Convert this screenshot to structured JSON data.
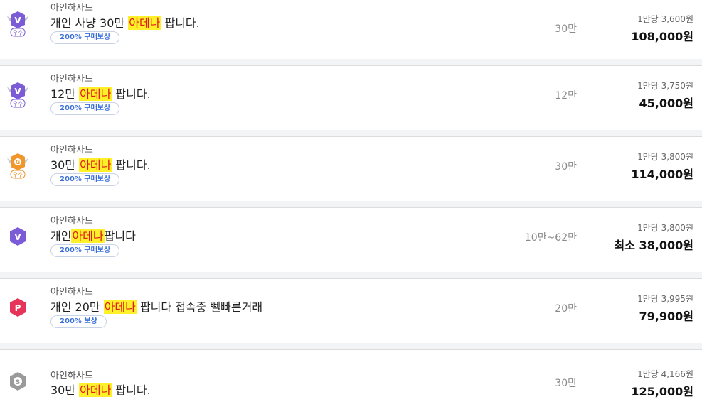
{
  "listings": [
    {
      "server": "아인하사드",
      "title_before": "개인 사냥 30만 ",
      "highlight": "아데나",
      "title_after": " 팝니다.",
      "tag": "200% 구매보상",
      "quantity": "30만",
      "unit_price": "1만당 3,600원",
      "total": "108,000원",
      "badge": {
        "icon": "v-grade-winged-icon",
        "letter": "V",
        "grade": "우수",
        "color": "#7b5bd6"
      }
    },
    {
      "server": "아인하사드",
      "title_before": "12만 ",
      "highlight": "아데나",
      "title_after": " 팝니다.",
      "tag": "200% 구매보상",
      "quantity": "12만",
      "unit_price": "1만당 3,750원",
      "total": "45,000원",
      "badge": {
        "icon": "v-grade-winged-icon",
        "letter": "V",
        "grade": "우수",
        "color": "#7b5bd6"
      }
    },
    {
      "server": "아인하사드",
      "title_before": "30만 ",
      "highlight": "아데나",
      "title_after": " 팝니다.",
      "tag": "200% 구매보상",
      "quantity": "30만",
      "unit_price": "1만당 3,800원",
      "total": "114,000원",
      "badge": {
        "icon": "g-grade-winged-icon",
        "letter": "G",
        "grade": "우수",
        "color": "#f0962a"
      }
    },
    {
      "server": "아인하사드",
      "title_before": "개인",
      "highlight": "아데나",
      "title_after": "팝니다",
      "tag": "200% 구매보상",
      "quantity": "10만~62만",
      "unit_price": "1만당 3,800원",
      "total": "최소 38,000원",
      "badge": {
        "icon": "v-grade-icon",
        "letter": "V",
        "grade": "",
        "color": "#7b5bd6"
      }
    },
    {
      "server": "아인하사드",
      "title_before": "개인 20만 ",
      "highlight": "아데나",
      "title_after": " 팝니다 접속중 뻴빠른거래",
      "tag": "200% 보상",
      "quantity": "20만",
      "unit_price": "1만당 3,995원",
      "total": "79,900원",
      "badge": {
        "icon": "p-grade-icon",
        "letter": "P",
        "grade": "",
        "color": "#e6335a"
      }
    },
    {
      "server": "아인하사드",
      "title_before": "30만 ",
      "highlight": "아데나",
      "title_after": " 팝니다.",
      "tag": "",
      "quantity": "30만",
      "unit_price": "1만당 4,166원",
      "total": "125,000원",
      "badge": {
        "icon": "s-grade-icon",
        "letter": "S",
        "grade": "",
        "color": "#9a9a9a"
      }
    }
  ]
}
